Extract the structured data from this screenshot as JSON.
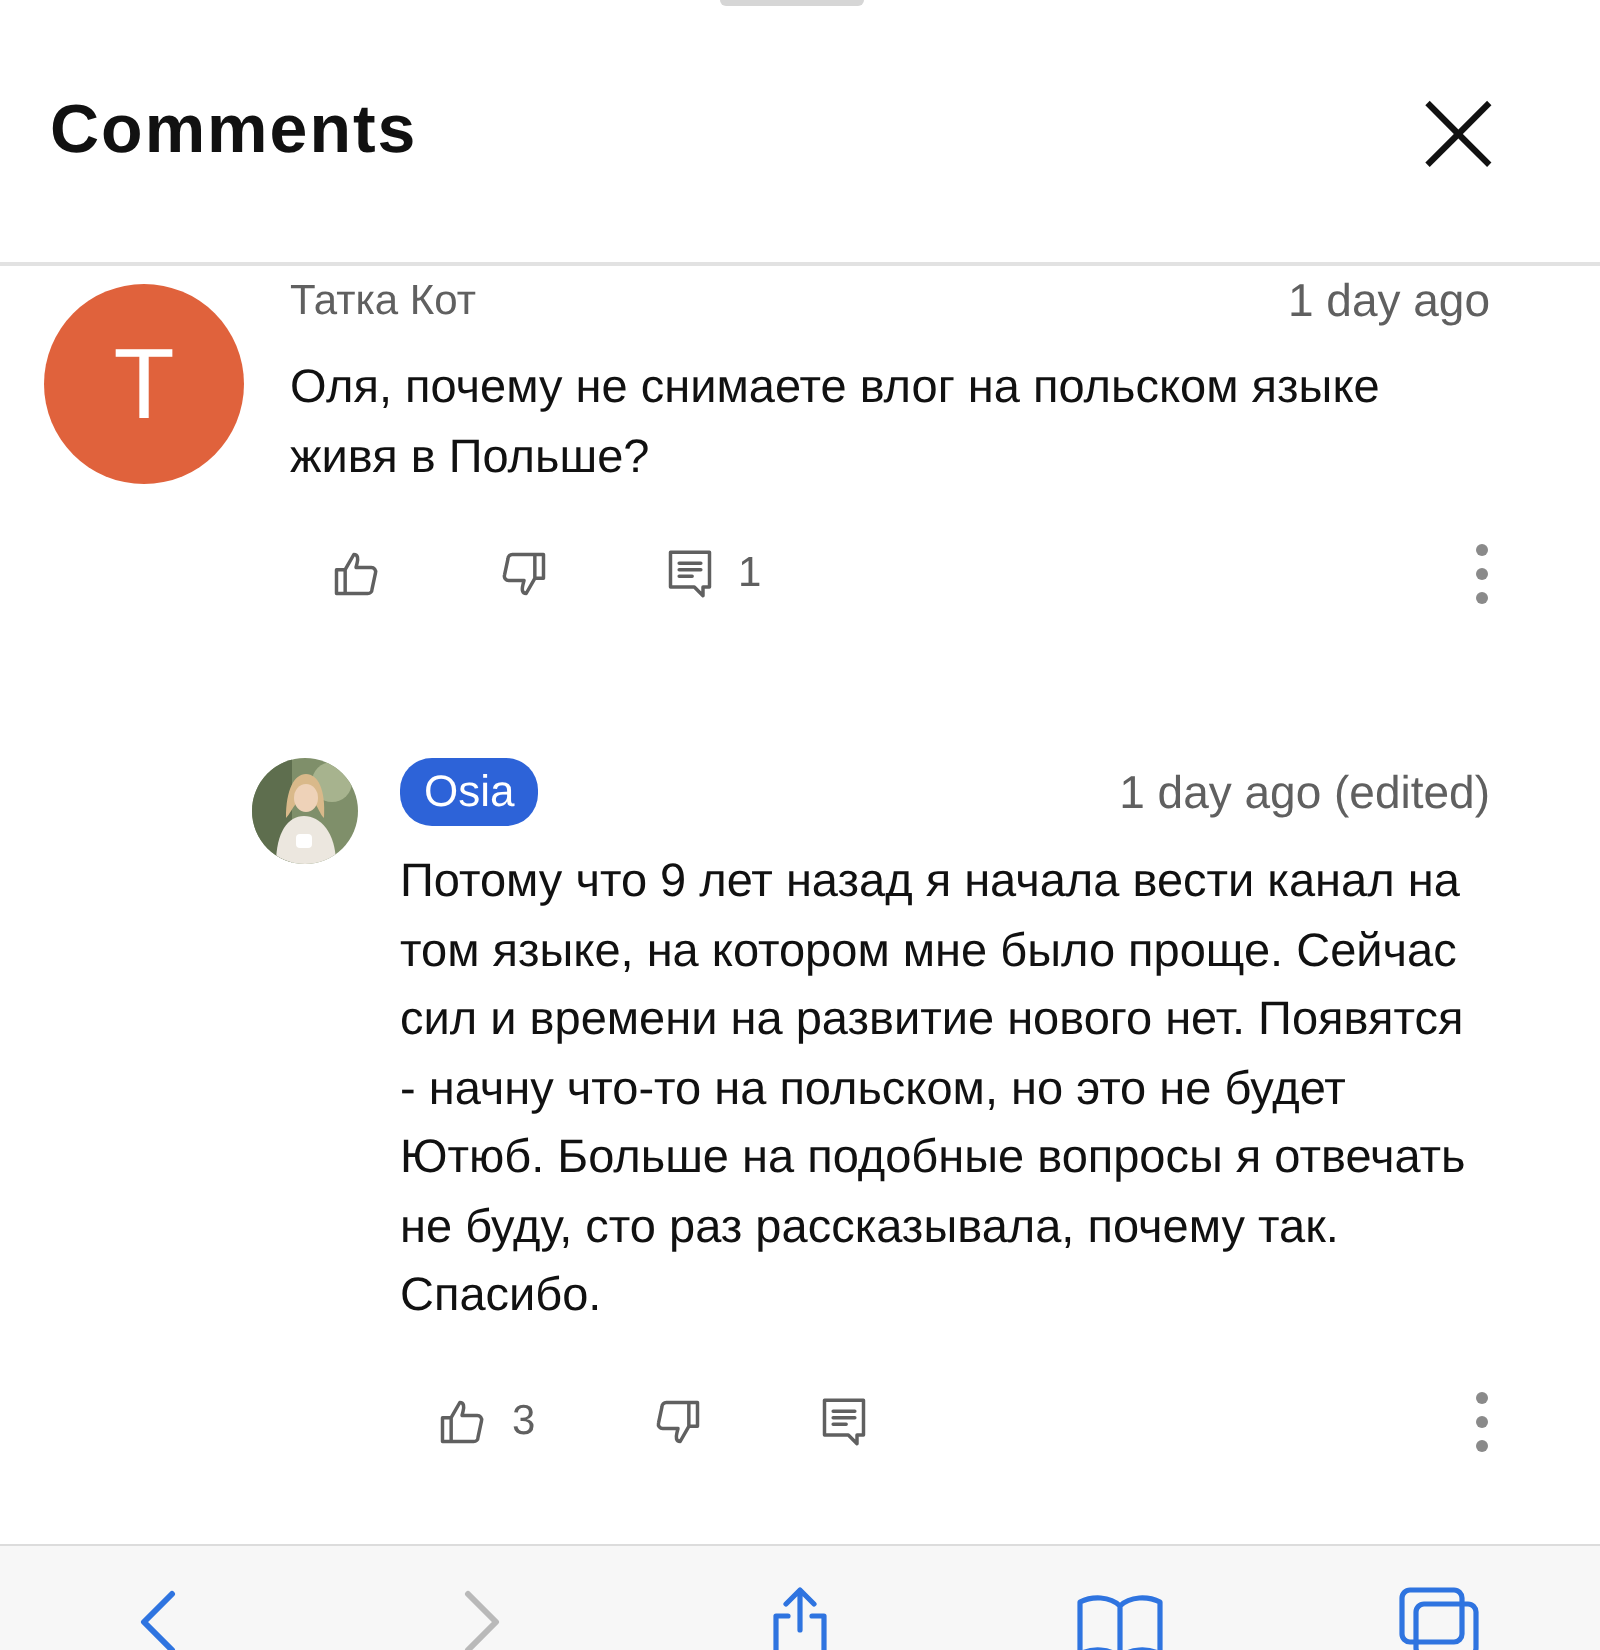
{
  "header": {
    "title": "Comments",
    "close_glyph": "×"
  },
  "comment": {
    "author": "Татка Кот",
    "is_creator": false,
    "avatar_letter": "T",
    "time": "1 day ago",
    "text": "Оля, почему не снимаете влог на польском языке живя в Польше?",
    "reply_count": "1"
  },
  "reply": {
    "author": "Osia",
    "is_creator": true,
    "time": "1 day ago (edited)",
    "text": "Потому что 9 лет назад я начала вести канал на том языке, на котором мне было проще. Сейчас сил и времени на развитие нового нет. Появятся - начну что-то на польском, но это не будет Ютюб. Больше на подобные вопросы я отвечать не буду, сто раз рассказывала, почему так. Спасибо.",
    "like_count": "3"
  },
  "toolbar": [
    {
      "kind": "back",
      "disabled": false
    },
    {
      "kind": "forward",
      "disabled": true
    },
    {
      "kind": "share",
      "disabled": false
    },
    {
      "kind": "bookmarks",
      "disabled": false
    },
    {
      "kind": "tabs",
      "disabled": false
    }
  ]
}
